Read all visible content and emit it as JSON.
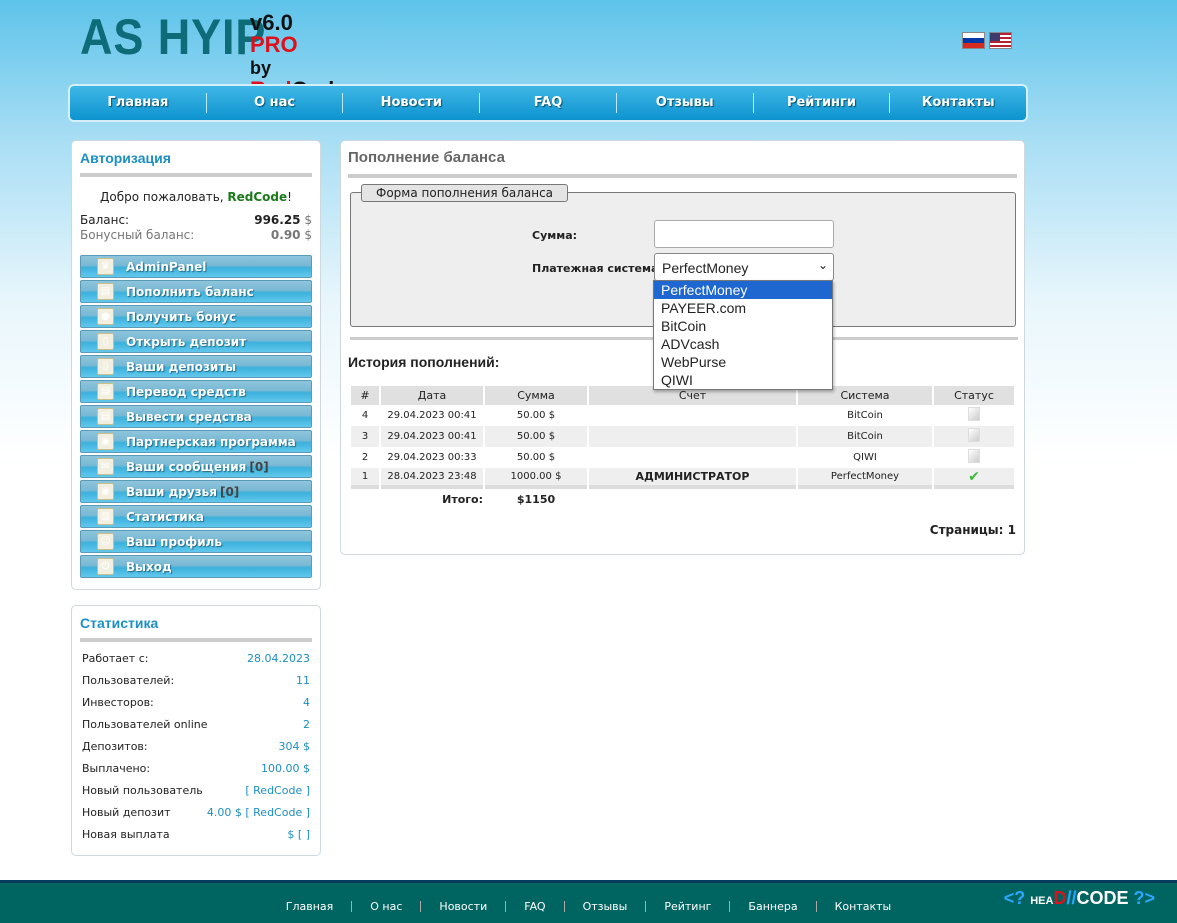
{
  "header": {
    "logo_main": "AS HYIP",
    "logo_version": "v6.0",
    "logo_pro": "PRO",
    "logo_by": "by",
    "logo_red": "Red",
    "logo_code": "Code",
    "flags": [
      "ru-flag",
      "us-flag"
    ]
  },
  "nav": [
    "Главная",
    "О нас",
    "Новости",
    "FAQ",
    "Отзывы",
    "Рейтинги",
    "Контакты"
  ],
  "auth": {
    "title": "Авторизация",
    "welcome": "Добро пожаловать, ",
    "user": "RedCode",
    "excl": "!",
    "balance_label": "Баланс:",
    "balance": "996.25",
    "bonus_label": "Бонусный баланс:",
    "bonus": "0.90",
    "currency": "$",
    "menu": [
      {
        "label": "AdminPanel",
        "icon": "crown-icon"
      },
      {
        "label": "Пополнить баланс",
        "icon": "money-add-icon"
      },
      {
        "label": "Получить бонус",
        "icon": "coins-icon"
      },
      {
        "label": "Открыть депозит",
        "icon": "document-icon"
      },
      {
        "label": "Ваши депозиты",
        "icon": "documents-icon"
      },
      {
        "label": "Перевод средств",
        "icon": "money-transfer-icon"
      },
      {
        "label": "Вывести средства",
        "icon": "money-out-icon"
      },
      {
        "label": "Партнерская программа",
        "icon": "partners-icon"
      },
      {
        "label": "Ваши сообщения",
        "icon": "envelope-icon",
        "count": "[0]"
      },
      {
        "label": "Ваши друзья",
        "icon": "friends-icon",
        "count": "[0]"
      },
      {
        "label": "Статистика",
        "icon": "chart-icon"
      },
      {
        "label": "Ваш профиль",
        "icon": "user-icon"
      },
      {
        "label": "Выход",
        "icon": "power-icon"
      }
    ]
  },
  "stats": {
    "title": "Статистика",
    "rows": [
      [
        "Работает с:",
        "28.04.2023"
      ],
      [
        "Пользователей:",
        "11"
      ],
      [
        "Инвесторов:",
        "4"
      ],
      [
        "Пользователей online",
        "2"
      ],
      [
        "Депозитов:",
        "304 $"
      ],
      [
        "Выплачено:",
        "100.00 $"
      ],
      [
        "Новый пользователь",
        "[ RedCode ]"
      ],
      [
        "Новый депозит",
        "4.00 $ [ RedCode ]"
      ],
      [
        "Новая выплата",
        "$ [ ]"
      ]
    ]
  },
  "main": {
    "title": "Пополнение баланса",
    "form_legend": "Форма пополнения баланса",
    "amount_label": "Сумма:",
    "amount_value": "",
    "system_label": "Платежная система:",
    "system_selected": "PerfectMoney",
    "options": [
      "PerfectMoney",
      "PAYEER.com",
      "BitCoin",
      "ADVcash",
      "WebPurse",
      "QIWI"
    ],
    "history_title": "История пополнений:",
    "columns": [
      "#",
      "Дата",
      "Сумма",
      "Счет",
      "Система",
      "Статус"
    ],
    "rows": [
      [
        "4",
        "29.04.2023 00:41",
        "50.00 $",
        "",
        "BitCoin",
        "pending"
      ],
      [
        "3",
        "29.04.2023 00:41",
        "50.00 $",
        "",
        "BitCoin",
        "pending"
      ],
      [
        "2",
        "29.04.2023 00:33",
        "50.00 $",
        "",
        "QIWI",
        "pending"
      ],
      [
        "1",
        "28.04.2023 23:48",
        "1000.00 $",
        "АДМИНИСТРАТОР",
        "PerfectMoney",
        "completed"
      ]
    ],
    "total_label": "Итого:",
    "total": "$1150",
    "pages": "Страницы: 1"
  },
  "footer": {
    "links": [
      "Главная",
      "О нас",
      "Новости",
      "FAQ",
      "Отзывы",
      "Рейтинг",
      "Баннера",
      "Контакты"
    ],
    "logo_text": "<? HEAD // CODE ?>"
  }
}
